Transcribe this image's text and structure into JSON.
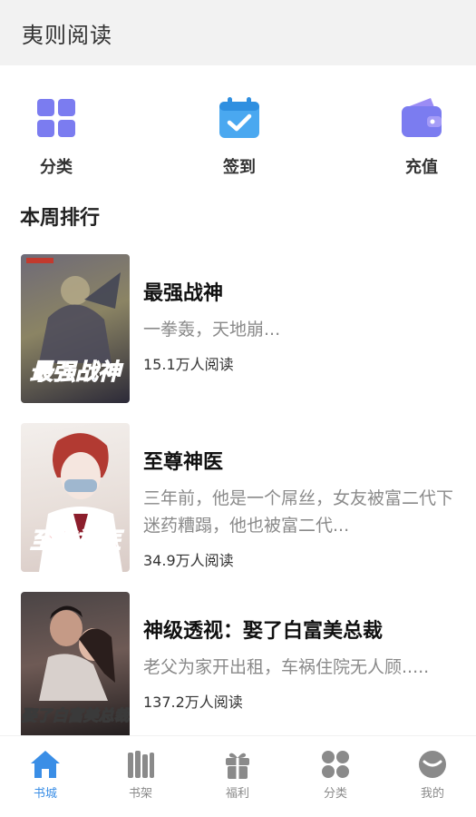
{
  "header": {
    "title": "夷则阅读"
  },
  "quick_nav": [
    {
      "label": "分类",
      "icon": "grid-icon"
    },
    {
      "label": "签到",
      "icon": "calendar-check-icon"
    },
    {
      "label": "充值",
      "icon": "wallet-icon"
    }
  ],
  "section": {
    "title": "本周排行"
  },
  "books": [
    {
      "title": "最强战神",
      "desc": "一拳轰，天地崩...",
      "reads": "15.1万人阅读",
      "cover_text": "最强战神",
      "cover_colors": [
        "#5a5b6e",
        "#8b8464",
        "#2c2a38"
      ]
    },
    {
      "title": "至尊神医",
      "desc": "三年前，他是一个屌丝，女友被富二代下迷药糟蹋，他也被富二代...",
      "reads": "34.9万人阅读",
      "cover_text": "至尊神医",
      "cover_colors": [
        "#f1ece8",
        "#c4504a",
        "#e7dcd6"
      ]
    },
    {
      "title": "神级透视：娶了白富美总裁",
      "desc": "老父为家开出租，车祸住院无人顾.....",
      "reads": "137.2万人阅读",
      "cover_text": "娶了白富美总裁",
      "cover_colors": [
        "#3a3435",
        "#a06c5d",
        "#1f1b1c"
      ]
    }
  ],
  "tabbar": [
    {
      "label": "书城",
      "icon": "home-icon",
      "active": true
    },
    {
      "label": "书架",
      "icon": "bookshelf-icon",
      "active": false
    },
    {
      "label": "福利",
      "icon": "gift-icon",
      "active": false
    },
    {
      "label": "分类",
      "icon": "category-icon",
      "active": false
    },
    {
      "label": "我的",
      "icon": "profile-icon",
      "active": false
    }
  ],
  "colors": {
    "accent": "#3a8ee6",
    "nav_icon_purple": "#7b7cf0",
    "tab_inactive": "#8a8a8a"
  }
}
